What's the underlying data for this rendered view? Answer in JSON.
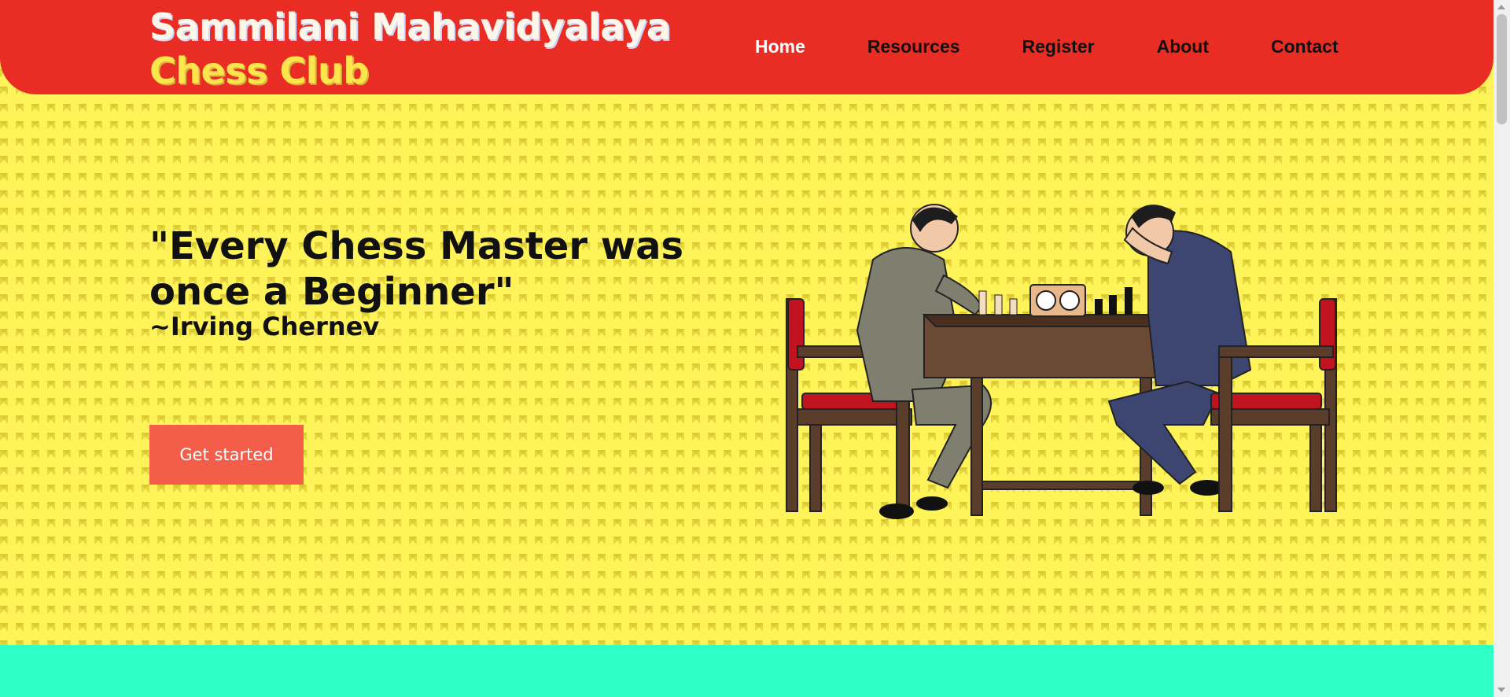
{
  "brand": {
    "line1": "Sammilani Mahavidyalaya",
    "line2": "Chess Club"
  },
  "nav": {
    "items": [
      "Home",
      "Resources",
      "Register",
      "About",
      "Contact"
    ],
    "active": "Home"
  },
  "hero": {
    "quote": "\"Every Chess Master was once a Beginner\"",
    "author": "~Irving Chernev",
    "cta_label": "Get started"
  },
  "colors": {
    "header": "#e92d24",
    "hero_background": "#fff35a",
    "cta": "#f45d4a",
    "bottom_band": "#2dffc5"
  }
}
